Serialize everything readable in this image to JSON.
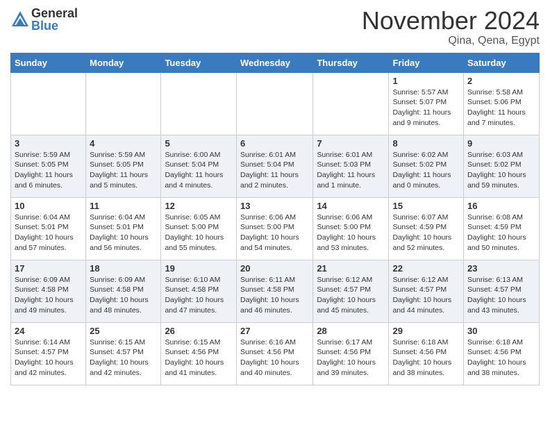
{
  "logo": {
    "general": "General",
    "blue": "Blue"
  },
  "header": {
    "month": "November 2024",
    "location": "Qina, Qena, Egypt"
  },
  "weekdays": [
    "Sunday",
    "Monday",
    "Tuesday",
    "Wednesday",
    "Thursday",
    "Friday",
    "Saturday"
  ],
  "weeks": [
    [
      {
        "day": "",
        "info": ""
      },
      {
        "day": "",
        "info": ""
      },
      {
        "day": "",
        "info": ""
      },
      {
        "day": "",
        "info": ""
      },
      {
        "day": "",
        "info": ""
      },
      {
        "day": "1",
        "info": "Sunrise: 5:57 AM\nSunset: 5:07 PM\nDaylight: 11 hours and 9 minutes."
      },
      {
        "day": "2",
        "info": "Sunrise: 5:58 AM\nSunset: 5:06 PM\nDaylight: 11 hours and 7 minutes."
      }
    ],
    [
      {
        "day": "3",
        "info": "Sunrise: 5:59 AM\nSunset: 5:05 PM\nDaylight: 11 hours and 6 minutes."
      },
      {
        "day": "4",
        "info": "Sunrise: 5:59 AM\nSunset: 5:05 PM\nDaylight: 11 hours and 5 minutes."
      },
      {
        "day": "5",
        "info": "Sunrise: 6:00 AM\nSunset: 5:04 PM\nDaylight: 11 hours and 4 minutes."
      },
      {
        "day": "6",
        "info": "Sunrise: 6:01 AM\nSunset: 5:04 PM\nDaylight: 11 hours and 2 minutes."
      },
      {
        "day": "7",
        "info": "Sunrise: 6:01 AM\nSunset: 5:03 PM\nDaylight: 11 hours and 1 minute."
      },
      {
        "day": "8",
        "info": "Sunrise: 6:02 AM\nSunset: 5:02 PM\nDaylight: 11 hours and 0 minutes."
      },
      {
        "day": "9",
        "info": "Sunrise: 6:03 AM\nSunset: 5:02 PM\nDaylight: 10 hours and 59 minutes."
      }
    ],
    [
      {
        "day": "10",
        "info": "Sunrise: 6:04 AM\nSunset: 5:01 PM\nDaylight: 10 hours and 57 minutes."
      },
      {
        "day": "11",
        "info": "Sunrise: 6:04 AM\nSunset: 5:01 PM\nDaylight: 10 hours and 56 minutes."
      },
      {
        "day": "12",
        "info": "Sunrise: 6:05 AM\nSunset: 5:00 PM\nDaylight: 10 hours and 55 minutes."
      },
      {
        "day": "13",
        "info": "Sunrise: 6:06 AM\nSunset: 5:00 PM\nDaylight: 10 hours and 54 minutes."
      },
      {
        "day": "14",
        "info": "Sunrise: 6:06 AM\nSunset: 5:00 PM\nDaylight: 10 hours and 53 minutes."
      },
      {
        "day": "15",
        "info": "Sunrise: 6:07 AM\nSunset: 4:59 PM\nDaylight: 10 hours and 52 minutes."
      },
      {
        "day": "16",
        "info": "Sunrise: 6:08 AM\nSunset: 4:59 PM\nDaylight: 10 hours and 50 minutes."
      }
    ],
    [
      {
        "day": "17",
        "info": "Sunrise: 6:09 AM\nSunset: 4:58 PM\nDaylight: 10 hours and 49 minutes."
      },
      {
        "day": "18",
        "info": "Sunrise: 6:09 AM\nSunset: 4:58 PM\nDaylight: 10 hours and 48 minutes."
      },
      {
        "day": "19",
        "info": "Sunrise: 6:10 AM\nSunset: 4:58 PM\nDaylight: 10 hours and 47 minutes."
      },
      {
        "day": "20",
        "info": "Sunrise: 6:11 AM\nSunset: 4:58 PM\nDaylight: 10 hours and 46 minutes."
      },
      {
        "day": "21",
        "info": "Sunrise: 6:12 AM\nSunset: 4:57 PM\nDaylight: 10 hours and 45 minutes."
      },
      {
        "day": "22",
        "info": "Sunrise: 6:12 AM\nSunset: 4:57 PM\nDaylight: 10 hours and 44 minutes."
      },
      {
        "day": "23",
        "info": "Sunrise: 6:13 AM\nSunset: 4:57 PM\nDaylight: 10 hours and 43 minutes."
      }
    ],
    [
      {
        "day": "24",
        "info": "Sunrise: 6:14 AM\nSunset: 4:57 PM\nDaylight: 10 hours and 42 minutes."
      },
      {
        "day": "25",
        "info": "Sunrise: 6:15 AM\nSunset: 4:57 PM\nDaylight: 10 hours and 42 minutes."
      },
      {
        "day": "26",
        "info": "Sunrise: 6:15 AM\nSunset: 4:56 PM\nDaylight: 10 hours and 41 minutes."
      },
      {
        "day": "27",
        "info": "Sunrise: 6:16 AM\nSunset: 4:56 PM\nDaylight: 10 hours and 40 minutes."
      },
      {
        "day": "28",
        "info": "Sunrise: 6:17 AM\nSunset: 4:56 PM\nDaylight: 10 hours and 39 minutes."
      },
      {
        "day": "29",
        "info": "Sunrise: 6:18 AM\nSunset: 4:56 PM\nDaylight: 10 hours and 38 minutes."
      },
      {
        "day": "30",
        "info": "Sunrise: 6:18 AM\nSunset: 4:56 PM\nDaylight: 10 hours and 38 minutes."
      }
    ]
  ]
}
